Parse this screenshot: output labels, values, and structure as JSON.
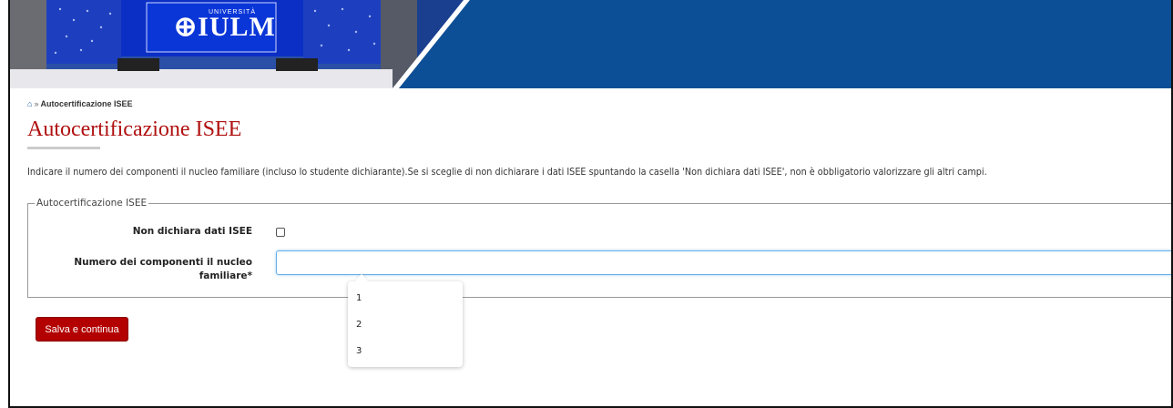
{
  "banner": {
    "logo_small": "UNIVERSITÀ",
    "logo_text": "IULM"
  },
  "breadcrumb": {
    "home_icon": "home-icon",
    "separator": "»",
    "current": "Autocertificazione ISEE"
  },
  "page": {
    "title": "Autocertificazione ISEE",
    "intro": "Indicare il numero dei componenti il nucleo familiare (incluso lo studente dichiarante).Se si sceglie di non dichiarare i dati ISEE spuntando la casella 'Non dichiara dati ISEE', non è obbligatorio valorizzare gli altri campi."
  },
  "form": {
    "legend": "Autocertificazione ISEE",
    "non_dichiara_label": "Non dichiara dati ISEE",
    "non_dichiara_checked": false,
    "numero_label": "Numero dei componenti il nucleo familiare*",
    "numero_value": "",
    "numero_options": [
      "1",
      "2",
      "3"
    ],
    "save_label": "Salva e continua"
  },
  "colors": {
    "banner_blue": "#0d4f96",
    "title_red": "#b01010",
    "button_red": "#b30000"
  }
}
